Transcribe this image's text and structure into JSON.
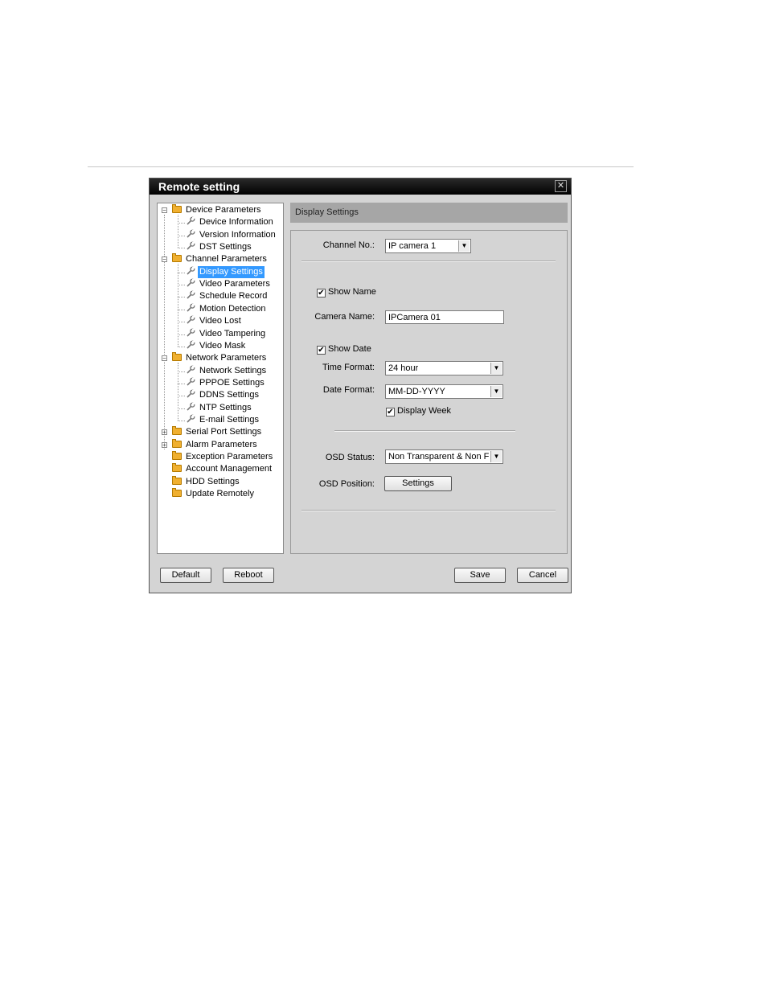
{
  "window": {
    "title": "Remote setting",
    "close_glyph": "✕"
  },
  "tree": {
    "items": [
      {
        "label": "Device Parameters",
        "type": "folder",
        "level": 0
      },
      {
        "label": "Device Information",
        "type": "leaf",
        "level": 1
      },
      {
        "label": "Version Information",
        "type": "leaf",
        "level": 1
      },
      {
        "label": "DST Settings",
        "type": "leaf",
        "level": 1
      },
      {
        "label": "Channel Parameters",
        "type": "folder",
        "level": 0
      },
      {
        "label": "Display Settings",
        "type": "leaf",
        "level": 1,
        "selected": true
      },
      {
        "label": "Video Parameters",
        "type": "leaf",
        "level": 1
      },
      {
        "label": "Schedule Record",
        "type": "leaf",
        "level": 1
      },
      {
        "label": "Motion Detection",
        "type": "leaf",
        "level": 1
      },
      {
        "label": "Video Lost",
        "type": "leaf",
        "level": 1
      },
      {
        "label": "Video Tampering",
        "type": "leaf",
        "level": 1
      },
      {
        "label": "Video Mask",
        "type": "leaf",
        "level": 1
      },
      {
        "label": "Network Parameters",
        "type": "folder",
        "level": 0
      },
      {
        "label": "Network Settings",
        "type": "leaf",
        "level": 1
      },
      {
        "label": "PPPOE Settings",
        "type": "leaf",
        "level": 1
      },
      {
        "label": "DDNS Settings",
        "type": "leaf",
        "level": 1
      },
      {
        "label": "NTP Settings",
        "type": "leaf",
        "level": 1
      },
      {
        "label": "E-mail Settings",
        "type": "leaf",
        "level": 1
      },
      {
        "label": "Serial Port Settings",
        "type": "folder",
        "level": 0
      },
      {
        "label": "Alarm Parameters",
        "type": "folder",
        "level": 0
      },
      {
        "label": "Exception Parameters",
        "type": "folder",
        "level": 0
      },
      {
        "label": "Account Management",
        "type": "folder",
        "level": 0
      },
      {
        "label": "HDD Settings",
        "type": "folder",
        "level": 0
      },
      {
        "label": "Update Remotely",
        "type": "folder",
        "level": 0
      }
    ]
  },
  "panel": {
    "header": "Display Settings",
    "channel_label": "Channel No.:",
    "channel_value": "IP camera 1",
    "show_name_label": "Show Name",
    "show_name_checked": "✔",
    "camera_name_label": "Camera Name:",
    "camera_name_value": "IPCamera 01",
    "show_date_label": "Show Date",
    "show_date_checked": "✔",
    "time_format_label": "Time Format:",
    "time_format_value": "24 hour",
    "date_format_label": "Date Format:",
    "date_format_value": "MM-DD-YYYY",
    "display_week_label": "Display Week",
    "display_week_checked": "✔",
    "osd_status_label": "OSD Status:",
    "osd_status_value": "Non Transparent & Non Flashing",
    "osd_position_label": "OSD Position:",
    "osd_position_button": "Settings",
    "dropdown_glyph": "▼"
  },
  "footer": {
    "default_label": "Default",
    "reboot_label": "Reboot",
    "save_label": "Save",
    "cancel_label": "Cancel"
  }
}
